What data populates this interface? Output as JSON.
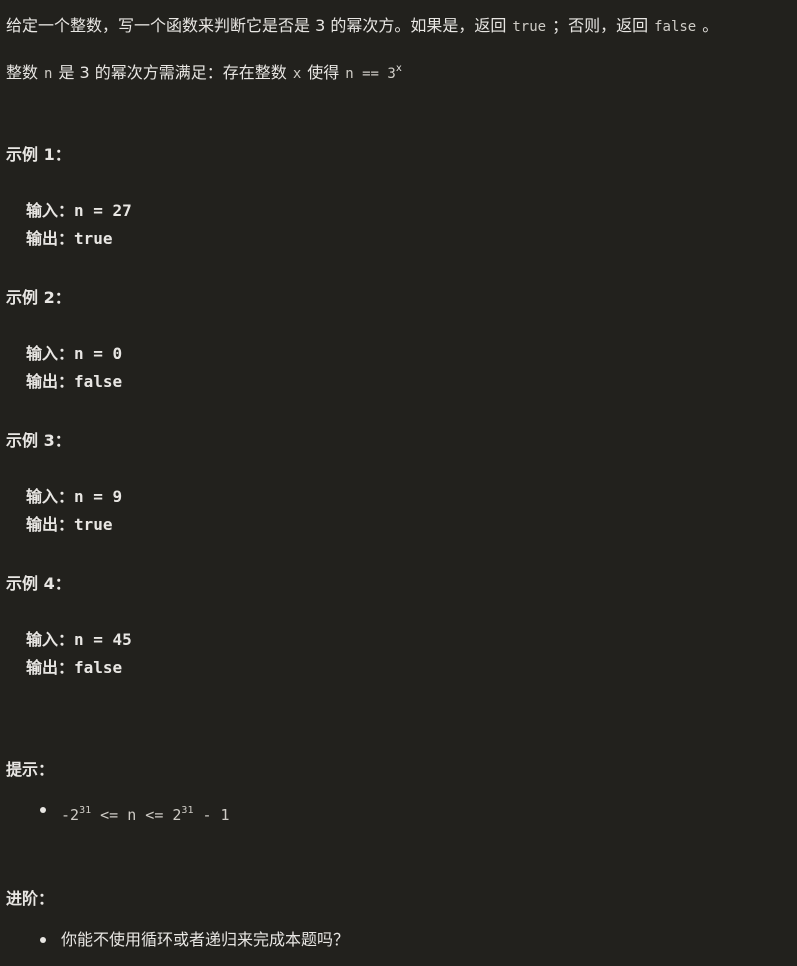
{
  "description": {
    "line1": {
      "part1": "给定一个整数，写一个函数来判断它是否是 3 的幂次方。如果是，返回",
      "code1": "true",
      "part2": "；否则，返回",
      "code2": "false",
      "part3": "。"
    },
    "line2": {
      "part1": "整数",
      "code_n": "n",
      "part2": "是 3 的幂次方需满足：存在整数",
      "code_x": "x",
      "part3": "使得",
      "code_expr": "n == 3",
      "sup": "x"
    }
  },
  "examples": [
    {
      "title": "示例 1：",
      "input_label": "输入：",
      "input_value": "n = 27",
      "output_label": "输出：",
      "output_value": "true"
    },
    {
      "title": "示例 2：",
      "input_label": "输入：",
      "input_value": "n = 0",
      "output_label": "输出：",
      "output_value": "false"
    },
    {
      "title": "示例 3：",
      "input_label": "输入：",
      "input_value": "n = 9",
      "output_label": "输出：",
      "output_value": "true"
    },
    {
      "title": "示例 4：",
      "input_label": "输入：",
      "input_value": "n = 45",
      "output_label": "输出：",
      "output_value": "false"
    }
  ],
  "hints": {
    "title": "提示：",
    "constraint": {
      "lhs": "-2",
      "lhs_sup": "31",
      "middle": " <= n <= 2",
      "rhs_sup": "31",
      "tail": " - 1"
    }
  },
  "advanced": {
    "title": "进阶：",
    "item": "你能不使用循环或者递归来完成本题吗？"
  }
}
